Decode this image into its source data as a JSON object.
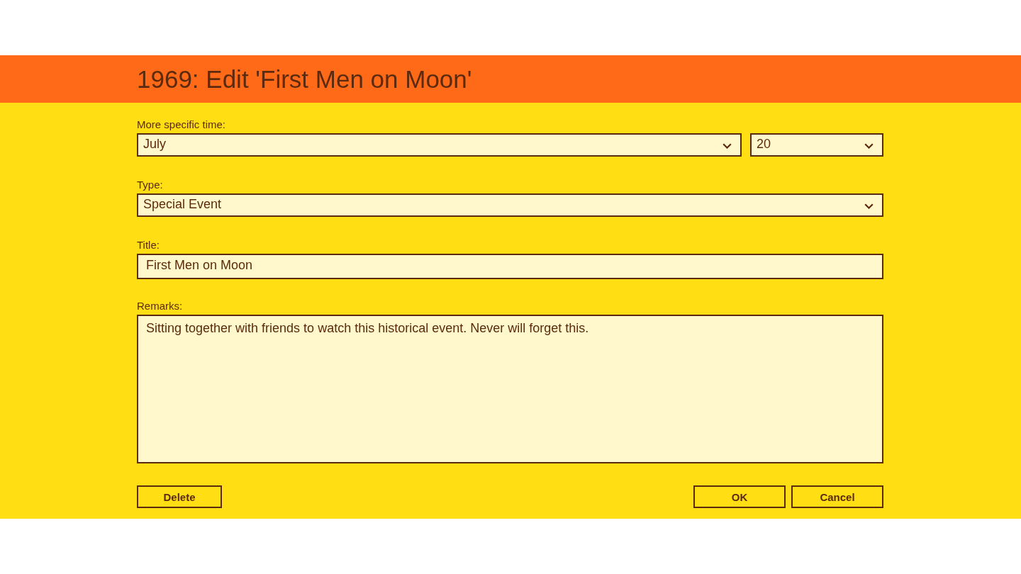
{
  "header": {
    "title": "1969: Edit 'First Men on Moon'"
  },
  "time": {
    "label": "More specific time:",
    "month": {
      "value": "July"
    },
    "day": {
      "value": "20"
    }
  },
  "type": {
    "label": "Type:",
    "value": "Special Event"
  },
  "title": {
    "label": "Title:",
    "value": "First Men on Moon"
  },
  "remarks": {
    "label": "Remarks:",
    "value": "Sitting together with friends to watch this historical event. Never will forget this."
  },
  "actions": {
    "left": [
      {
        "label": "Delete"
      }
    ],
    "right": [
      {
        "label": "OK"
      },
      {
        "label": "Cancel"
      }
    ]
  }
}
